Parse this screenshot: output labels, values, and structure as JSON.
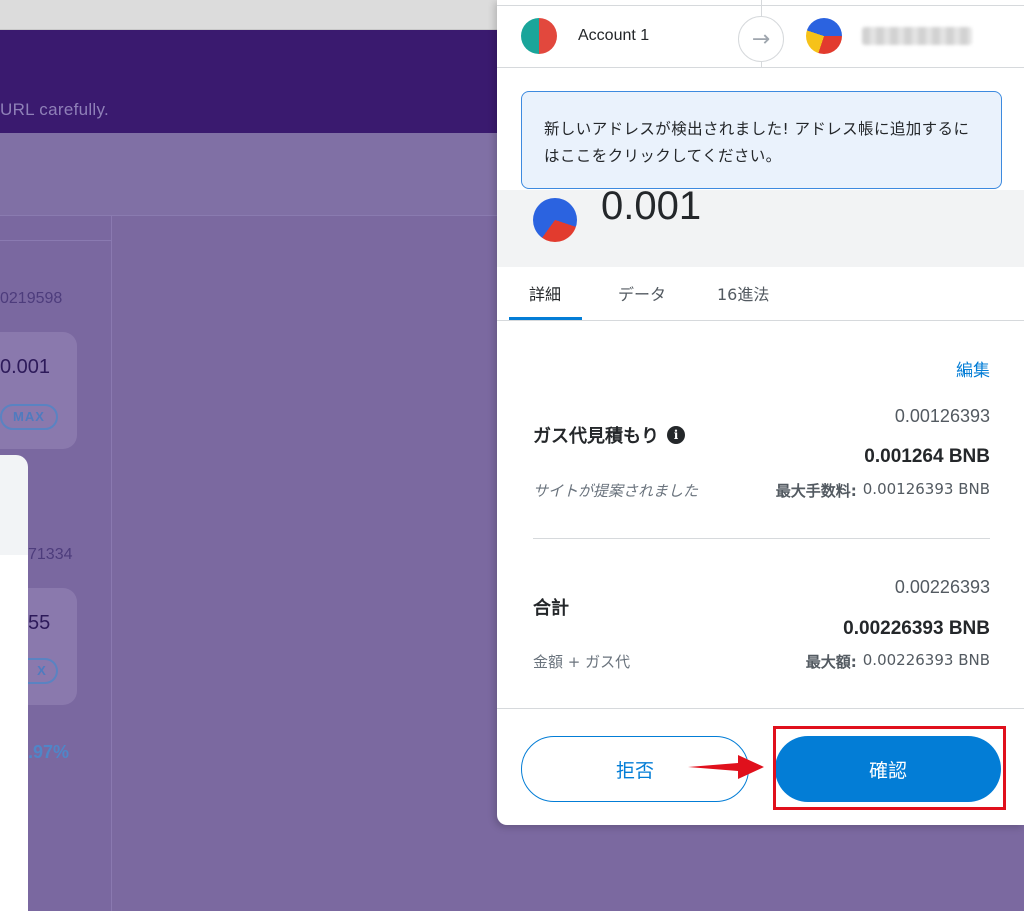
{
  "background": {
    "banner_text": "URL carefully.",
    "balance_1": "0219598",
    "amount_1": "0.001",
    "max_1": "MAX",
    "balance_2": "71334",
    "amount_2": "55",
    "max_2": "X",
    "percent": ".97%"
  },
  "popup": {
    "from_account": "Account 1",
    "notice": "新しいアドレスが検出されました! アドレス帳に追加するにはここをクリックしてください。",
    "amount": "0.001",
    "tabs": [
      {
        "label": "詳細",
        "active": true
      },
      {
        "label": "データ",
        "active": false
      },
      {
        "label": "16進法",
        "active": false
      }
    ],
    "edit_label": "編集",
    "gas": {
      "label": "ガス代見積もり",
      "info_icon": "i",
      "value_secondary": "0.00126393",
      "value_primary": "0.001264 BNB",
      "note": "サイトが提案されました",
      "max_fee_label": "最大手数料:",
      "max_fee_value": "0.00126393 BNB"
    },
    "total": {
      "label": "合計",
      "value_secondary": "0.00226393",
      "value_primary": "0.00226393 BNB",
      "note": "金額 + ガス代",
      "max_label": "最大額:",
      "max_value": "0.00226393 BNB"
    },
    "reject_label": "拒否",
    "confirm_label": "確認"
  },
  "colors": {
    "accent": "#037dd6",
    "highlight_box": "#e0101c",
    "background_purple": "#7b69a0"
  }
}
